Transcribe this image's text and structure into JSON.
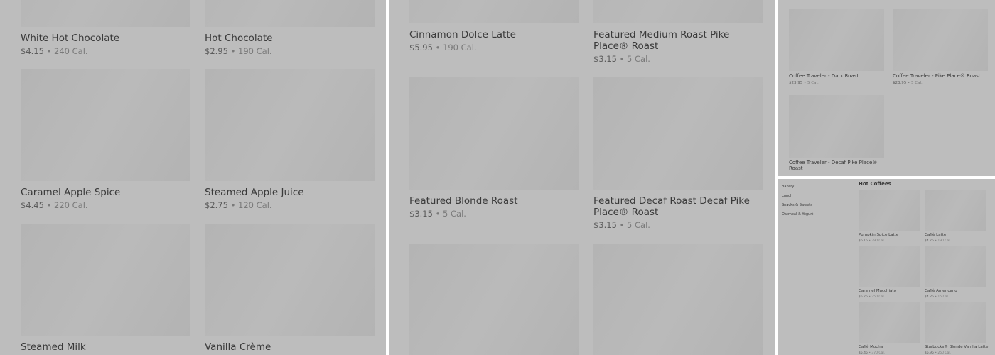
{
  "panel1": {
    "items": [
      {
        "name": "White Hot Chocolate",
        "price": "$4.15",
        "cal": "240 Cal."
      },
      {
        "name": "Hot Chocolate",
        "price": "$2.95",
        "cal": "190 Cal."
      },
      {
        "name": "Caramel Apple Spice",
        "price": "$4.45",
        "cal": "220 Cal."
      },
      {
        "name": "Steamed Apple Juice",
        "price": "$2.75",
        "cal": "120 Cal."
      },
      {
        "name": "Steamed Milk",
        "price": "",
        "cal": ""
      },
      {
        "name": "Vanilla Crème",
        "price": "",
        "cal": ""
      }
    ]
  },
  "panel2": {
    "items": [
      {
        "name": "Cinnamon Dolce Latte",
        "price": "$5.95",
        "cal": "190 Cal."
      },
      {
        "name": "Featured Medium Roast Pike Place® Roast",
        "price": "$3.15",
        "cal": "5 Cal."
      },
      {
        "name": "Featured Blonde Roast",
        "price": "$3.15",
        "cal": "5 Cal."
      },
      {
        "name": "Featured Decaf Roast Decaf Pike Place® Roast",
        "price": "$3.15",
        "cal": "5 Cal."
      }
    ]
  },
  "panel3": {
    "items": [
      {
        "name": "Coffee Traveler - Dark Roast",
        "price": "$23.95",
        "cal": "5 Cal."
      },
      {
        "name": "Coffee Traveler - Pike Place® Roast",
        "price": "$23.95",
        "cal": "5 Cal."
      },
      {
        "name": "Coffee Traveler - Decaf Pike Place® Roast",
        "price": "",
        "cal": ""
      }
    ]
  },
  "panel4": {
    "sidebar": [
      "Bakery",
      "Lunch",
      "Snacks & Sweets",
      "Oatmeal & Yogurt"
    ],
    "section_title": "Hot Coffees",
    "items": [
      {
        "name": "Pumpkin Spice Latte",
        "price": "$6.15",
        "cal": "390 Cal."
      },
      {
        "name": "Caffè Latte",
        "price": "$4.75",
        "cal": "190 Cal."
      },
      {
        "name": "Caramel Macchiato",
        "price": "$5.75",
        "cal": "250 Cal."
      },
      {
        "name": "Caffè Americano",
        "price": "$4.25",
        "cal": "15 Cal."
      },
      {
        "name": "Caffè Mocha",
        "price": "$5.45",
        "cal": "370 Cal."
      },
      {
        "name": "Starbucks® Blonde Vanilla Latte",
        "price": "$5.95",
        "cal": "250 Cal."
      }
    ]
  },
  "separator": " • "
}
